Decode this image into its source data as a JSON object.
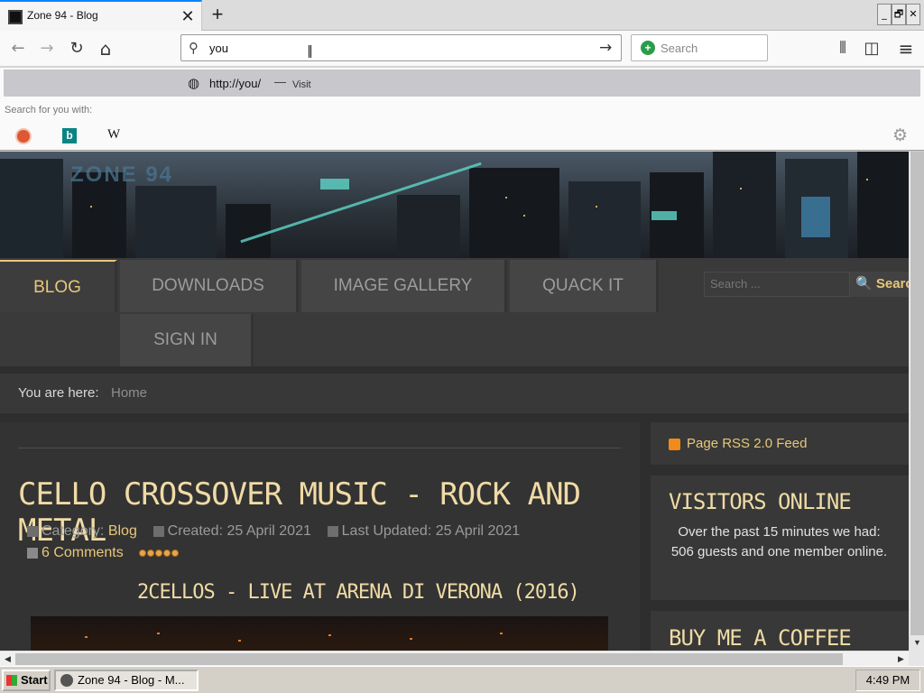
{
  "browser": {
    "tab_title": "Zone 94 - Blog",
    "tab_close": "✕",
    "new_tab": "+",
    "window_buttons": [
      "_",
      "🗗",
      "✕"
    ],
    "url_value": "you",
    "search_placeholder": "Search",
    "nav": {
      "back": "←",
      "forward": "→",
      "reload": "↻",
      "home": "⌂",
      "go": "→",
      "library": "⫴",
      "sidebar": "◫",
      "menu": "≡"
    }
  },
  "dropdown": {
    "suggest_url": "http://you/",
    "suggest_dash": "—",
    "suggest_visit": "Visit",
    "search_for": "Search for you with:",
    "engines": [
      "DuckDuckGo",
      "Bing",
      "W"
    ]
  },
  "site": {
    "menu": {
      "blog": "BLOG",
      "downloads": "DOWNLOADS",
      "gallery": "IMAGE GALLERY",
      "quack": "QUACK IT",
      "signin": "SIGN IN"
    },
    "search_placeholder": "Search ...",
    "search_button": "🔍 Search",
    "breadcrumb_label": "You are here:",
    "breadcrumb_home": "Home",
    "article": {
      "title": "CELLO CROSSOVER MUSIC - ROCK AND METAL",
      "category_label": "Category:",
      "category": "Blog",
      "created": "Created: 25 April 2021",
      "updated": "Last Updated: 25 April 2021",
      "comments": "6 Comments",
      "rating": 5,
      "subtitle": "2CELLOS - LIVE AT ARENA DI VERONA (2016)"
    },
    "sidebar": {
      "rss": "Page RSS 2.0 Feed",
      "visitors_title": "VISITORS ONLINE",
      "visitors_text": "Over the past 15 minutes we had: 506 guests and one member online.",
      "coffee_title": "BUY ME A COFFEE"
    }
  },
  "taskbar": {
    "start": "Start",
    "task": "Zone 94 - Blog - M...",
    "clock": "4:49 PM"
  },
  "colors": {
    "accent": "#e8c77b",
    "title": "#f0dba6",
    "page_bg": "#2e2e2e"
  }
}
